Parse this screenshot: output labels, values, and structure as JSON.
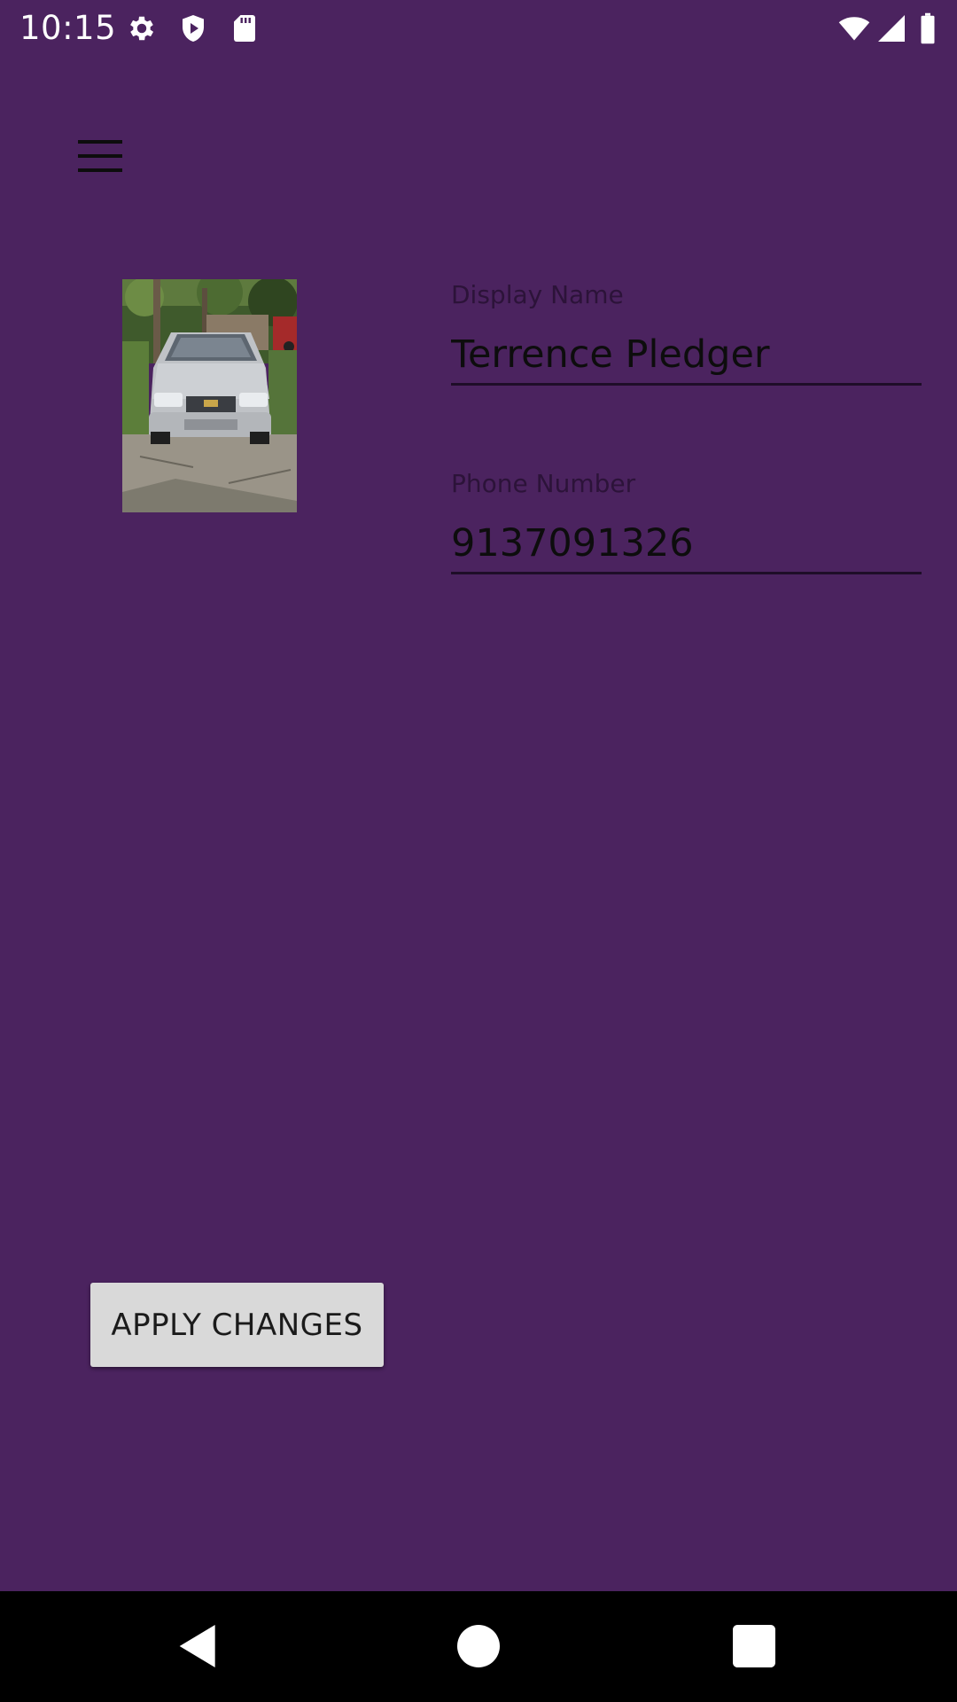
{
  "status_bar": {
    "time": "10:15",
    "left_icons": [
      "gear-icon",
      "shield-play-icon",
      "sd-card-icon"
    ],
    "right_icons": [
      "wifi-icon",
      "cell-signal-icon",
      "battery-icon"
    ]
  },
  "toolbar": {
    "menu_icon": "hamburger-menu-icon"
  },
  "profile": {
    "photo_alt": "profile photo (car)",
    "display_name": {
      "label": "Display Name",
      "value": "Terrence Pledger"
    },
    "phone_number": {
      "label": "Phone Number",
      "value": "9137091326"
    }
  },
  "actions": {
    "apply_label": "APPLY CHANGES"
  },
  "nav_bar": {
    "icons": [
      "back-icon",
      "home-icon",
      "recents-icon"
    ]
  },
  "colors": {
    "background": "#4B235F",
    "button": "#D9D9D9",
    "nav_bar": "#000000"
  }
}
